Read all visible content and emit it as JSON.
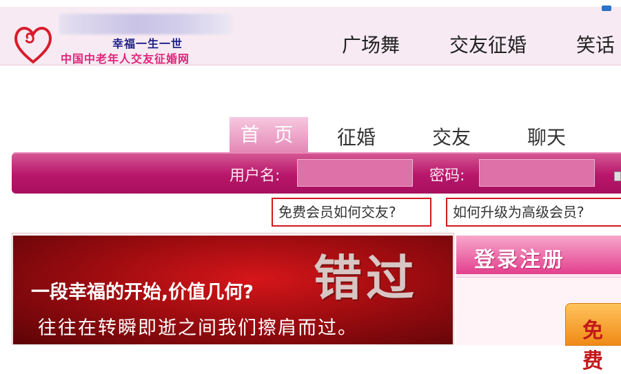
{
  "logo": {
    "line1": "幸福一生一世",
    "line2": "中国中老年人交友征婚网"
  },
  "top_nav": [
    "广场舞",
    "交友征婚",
    "笑话"
  ],
  "tabs": [
    "首 页",
    "征婚",
    "交友",
    "聊天"
  ],
  "login": {
    "username_label": "用户名:",
    "password_label": "密码:",
    "username_value": "",
    "password_value": ""
  },
  "help_links": [
    "免费会员如何交友?",
    "如何升级为高级会员?"
  ],
  "banner": {
    "big_text": "错过",
    "line1": "一段幸福的开始,价值几何?",
    "line2": "往往在转瞬即逝之间我们擦肩而过。"
  },
  "side": {
    "header": "登录注册",
    "button": "免费"
  },
  "colors": {
    "brand_pink": "#e0257a",
    "bar_magenta": "#b8176a",
    "help_border": "#d4161c",
    "banner_red": "#9f0c10"
  }
}
